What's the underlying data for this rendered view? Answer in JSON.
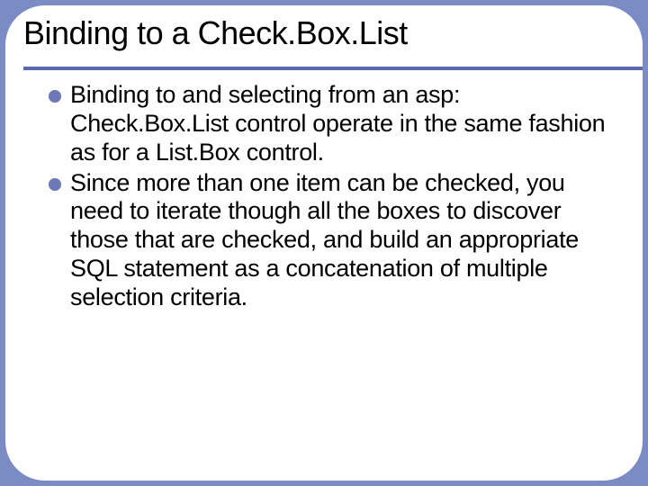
{
  "slide": {
    "title": "Binding to a Check.Box.List",
    "bullets": [
      "Binding to and selecting from an asp: Check.Box.List control operate in the same fashion as for a List.Box control.",
      "Since more than one item can be checked, you need to iterate though all the boxes to discover those that are checked, and build an appropriate SQL statement as a concatenation of multiple selection criteria."
    ]
  },
  "colors": {
    "background": "#7b8bc4",
    "accent": "#5a6bb0",
    "bullet": "#6b7ab5"
  }
}
